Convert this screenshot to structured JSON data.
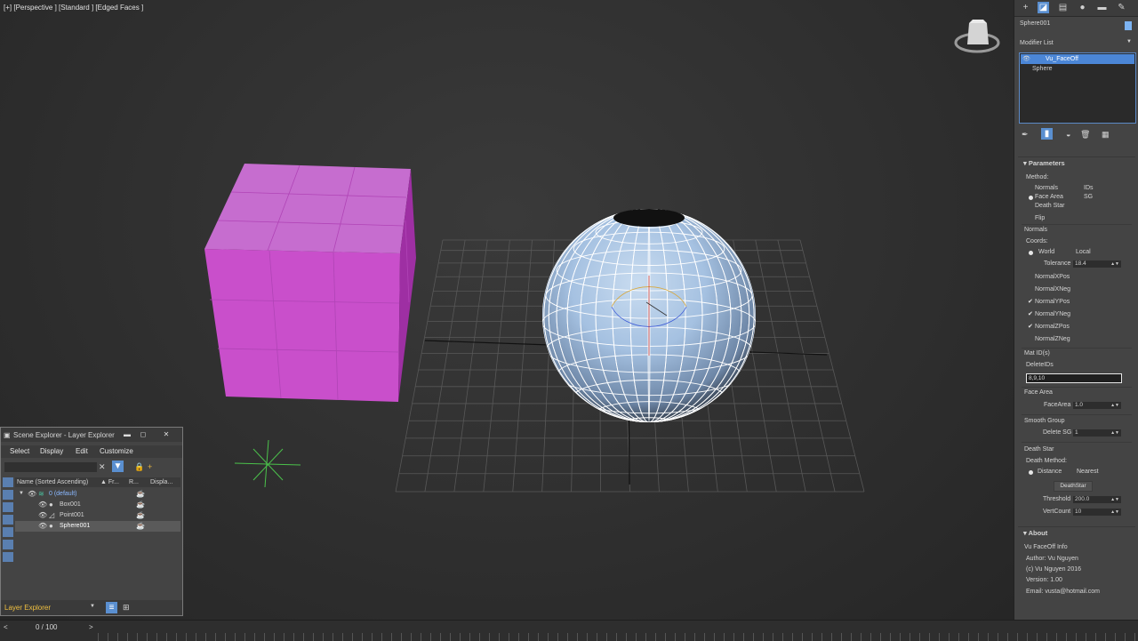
{
  "viewport": {
    "label": "[+] [Perspective ] [Standard ] [Edged Faces ]"
  },
  "command_panel": {
    "object_name": "Sphere001",
    "modifier_list_label": "Modifier List",
    "modifier_stack": [
      "Vu_FaceOff",
      "Sphere"
    ],
    "parameters": {
      "title": "Parameters",
      "method_label": "Method:",
      "method_options": [
        "Normals",
        "IDs",
        "Face Area",
        "SG",
        "Death Star",
        "Flip"
      ],
      "method_selected": "Face Area",
      "normals_group": "Normals",
      "coords_label": "Coords:",
      "coords_world": "World",
      "coords_local": "Local",
      "tolerance_label": "Tolerance",
      "tolerance_value": "18.4",
      "normal_checks": [
        {
          "label": "NormalXPos",
          "checked": "no"
        },
        {
          "label": "NormalXNeg",
          "checked": "no"
        },
        {
          "label": "NormalYPos",
          "checked": "yes"
        },
        {
          "label": "NormalYNeg",
          "checked": "yes"
        },
        {
          "label": "NormalZPos",
          "checked": "yes"
        },
        {
          "label": "NormalZNeg",
          "checked": "no"
        }
      ],
      "matid_group": "Mat ID(s)",
      "delete_ids_label": "DeleteIDs",
      "delete_ids_value": "8,9,10",
      "face_area_group": "Face Area",
      "face_area_label": "FaceArea",
      "face_area_value": "1.0",
      "smooth_group": "Smooth Group",
      "delete_sg_label": "Delete SG",
      "delete_sg_value": "1",
      "death_star_group": "Death Star",
      "death_method_label": "Death Method:",
      "death_distance": "Distance",
      "death_nearest": "Nearest",
      "deathstar_button": "DeathStar",
      "threshold_label": "Threshold",
      "threshold_value": "200.0",
      "vertcount_label": "VertCount",
      "vertcount_value": "10"
    },
    "about": {
      "title": "About",
      "lines": [
        "Vu FaceOff Info",
        "Author: Vu Nguyen",
        "(c) Vu Nguyen 2016",
        "Version: 1.00",
        "Email: vusta@hotmail.com"
      ]
    }
  },
  "scene_explorer": {
    "title": "Scene Explorer - Layer Explorer",
    "menu": [
      "Select",
      "Display",
      "Edit",
      "Customize"
    ],
    "columns": [
      "Name (Sorted Ascending)",
      "▲ Fr...",
      "R...",
      "Displa..."
    ],
    "rows": [
      {
        "name": "0 (default)",
        "type": "layer"
      },
      {
        "name": "Box001",
        "type": "object"
      },
      {
        "name": "Point001",
        "type": "object"
      },
      {
        "name": "Sphere001",
        "type": "object"
      }
    ],
    "footer": "Layer Explorer"
  },
  "timeline": {
    "frame": "0 / 100",
    "prev": "<",
    "next": ">"
  },
  "colors": {
    "box": "#c850c8",
    "sphere": "#a9c6e6",
    "wire": "#ffffff",
    "selection": "#4b86d6"
  }
}
